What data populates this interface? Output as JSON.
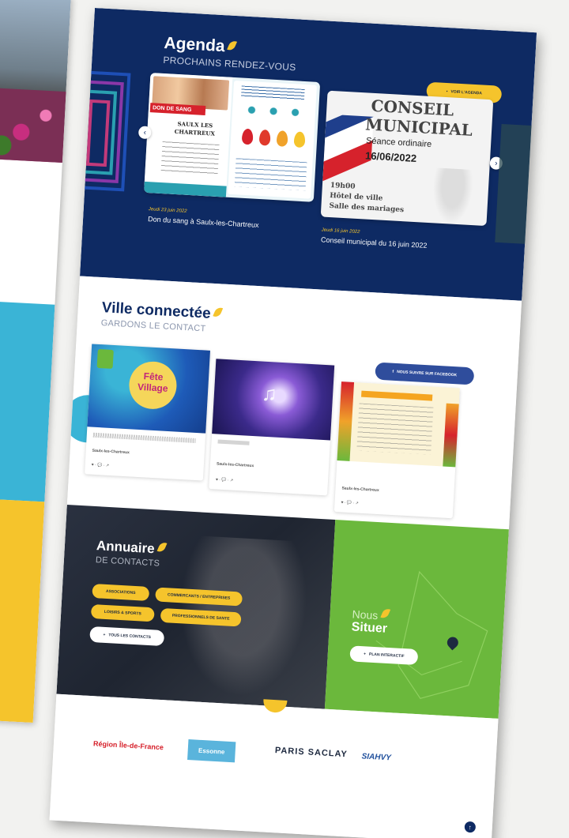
{
  "agenda": {
    "title": "Agenda",
    "subtitle": "PROCHAINS RENDEZ-VOUS",
    "all_button": "VOIR L'AGENDA",
    "events": [
      {
        "date": "Jeudi 23 juin 2022",
        "title": "Don du sang à Saulx-les-Chartreux",
        "poster_top": "DON DE SANG",
        "poster_city": "SAULX LES CHARTREUX"
      },
      {
        "date": "Jeudi 16 juin 2022",
        "title": "Conseil municipal du 16 juin 2022",
        "poster_line1": "CONSEIL",
        "poster_line2": "MUNICIPAL",
        "poster_line3": "Séance ordinaire",
        "poster_line4": "16/06/2022",
        "poster_line5": "19h00",
        "poster_line6": "Hôtel de ville",
        "poster_line7": "Salle des mariages"
      }
    ]
  },
  "connect": {
    "title": "Ville connectée",
    "subtitle": "GARDONS LE CONTACT",
    "follow_button": "NOUS SUIVRE SUR FACEBOOK",
    "posts": [
      {
        "poster_l1": "Fête",
        "poster_l2": "Village",
        "source": "Saulx-les-Chartreux"
      },
      {
        "source": "Saulx-les-Chartreux"
      },
      {
        "source": "Saulx-les-Chartreux"
      }
    ]
  },
  "annuaire": {
    "title": "Annuaire",
    "subtitle": "DE CONTACTS",
    "chips": [
      "ASSOCIATIONS",
      "COMMERCANTS / ENTREPRISES",
      "LOISIRS & SPORTS",
      "PROFESSIONNELS DE SANTE"
    ],
    "all_button": "TOUS LES CONTACTS"
  },
  "situer": {
    "title_light": "Nous",
    "title_bold": "Situer",
    "button": "PLAN INTERACTIF"
  },
  "partners": {
    "logos": [
      "Région Île-de-France",
      "Essonne",
      "PARIS SACLAY",
      "SIAHVY"
    ]
  },
  "colors": {
    "navy": "#0e2a63",
    "yellow": "#f5c42c",
    "green": "#6bb83c",
    "cyan": "#3ab4d6"
  }
}
